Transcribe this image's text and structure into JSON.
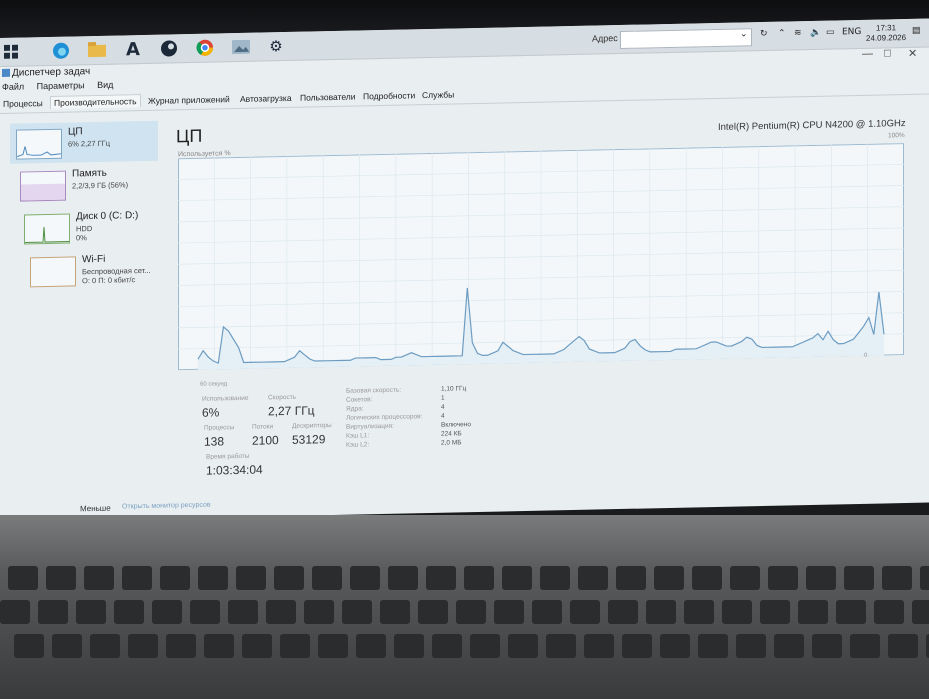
{
  "taskbar": {
    "icons": [
      "windows-start-icon",
      "edge-icon",
      "file-explorer-icon",
      "font-a-icon",
      "steam-icon",
      "chrome-icon",
      "picture-icon",
      "settings-gear-icon"
    ],
    "address_label": "Адрес",
    "lang": "ENG",
    "time": "17:31",
    "date": "24.09.2026"
  },
  "window": {
    "title": "Диспетчер задач",
    "menu": [
      "Файл",
      "Параметры",
      "Вид"
    ],
    "tabs": [
      "Процессы",
      "Производительность",
      "Журнал приложений",
      "Автозагрузка",
      "Пользователи",
      "Подробности",
      "Службы"
    ],
    "active_tab": "Производительность"
  },
  "sidebar": {
    "items": [
      {
        "title": "ЦП",
        "sub": "6% 2,27 ГГц",
        "sub2": ""
      },
      {
        "title": "Память",
        "sub": "2,2/3,9 ГБ (56%)",
        "sub2": ""
      },
      {
        "title": "Диск 0 (C: D:)",
        "sub": "HDD",
        "sub2": "0%"
      },
      {
        "title": "Wi-Fi",
        "sub": "Беспроводная сет...",
        "sub2": "О: 0 П: 0 кбит/с"
      }
    ]
  },
  "main": {
    "title": "ЦП",
    "cpu_name": "Intel(R) Pentium(R) CPU N4200 @ 1.10GHz",
    "util_label": "Используется %",
    "pct_max": "100%",
    "axis_left": "60 секунд",
    "axis_right": "0",
    "stats": {
      "util_label": "Использование",
      "util_value": "6%",
      "speed_label": "Скорость",
      "speed_value": "2,27 ГГц",
      "proc_label": "Процессы",
      "proc_value": "138",
      "threads_label": "Потоки",
      "threads_value": "2100",
      "handles_label": "Дескрипторы",
      "handles_value": "53129",
      "uptime_label": "Время работы",
      "uptime_value": "1:03:34:04"
    },
    "details": [
      {
        "k": "Базовая скорость:",
        "v": "1,10 ГГц"
      },
      {
        "k": "Сокетов:",
        "v": "1"
      },
      {
        "k": "Ядра:",
        "v": "4"
      },
      {
        "k": "Логических процессоров:",
        "v": "4"
      },
      {
        "k": "Виртуализация:",
        "v": "Включено"
      },
      {
        "k": "Кэш L1:",
        "v": "224 КБ"
      },
      {
        "k": "Кэш L2:",
        "v": "2,0 МБ"
      }
    ]
  },
  "footer": {
    "less": "Меньше",
    "monitor": "Открыть монитор ресурсов"
  },
  "chart_data": {
    "type": "line",
    "ylim": [
      0,
      100
    ],
    "values": [
      5,
      9,
      6,
      4,
      3,
      20,
      18,
      14,
      10,
      3,
      3,
      3,
      3,
      3,
      3,
      3,
      3,
      3,
      4,
      5,
      8,
      6,
      4,
      3,
      3,
      3,
      3,
      3,
      3,
      3,
      3,
      4,
      4,
      4,
      4,
      4,
      3,
      3,
      3,
      4,
      4,
      5,
      6,
      5,
      4,
      4,
      4,
      4,
      4,
      4,
      4,
      4,
      4,
      36,
      10,
      5,
      4,
      4,
      5,
      6,
      10,
      8,
      6,
      5,
      4,
      4,
      4,
      4,
      4,
      4,
      4,
      5,
      6,
      8,
      10,
      12,
      10,
      6,
      5,
      4,
      4,
      4,
      4,
      5,
      6,
      9,
      10,
      7,
      5,
      4,
      4,
      4,
      4,
      4,
      5,
      5,
      5,
      5,
      5,
      6,
      7,
      8,
      8,
      7,
      6,
      6,
      7,
      8,
      10,
      9,
      6,
      5,
      5,
      5,
      5,
      5,
      5,
      5,
      6,
      7,
      8,
      9,
      11,
      8,
      12,
      8,
      6,
      6,
      7,
      8,
      11,
      14,
      18,
      10,
      30,
      10
    ]
  }
}
